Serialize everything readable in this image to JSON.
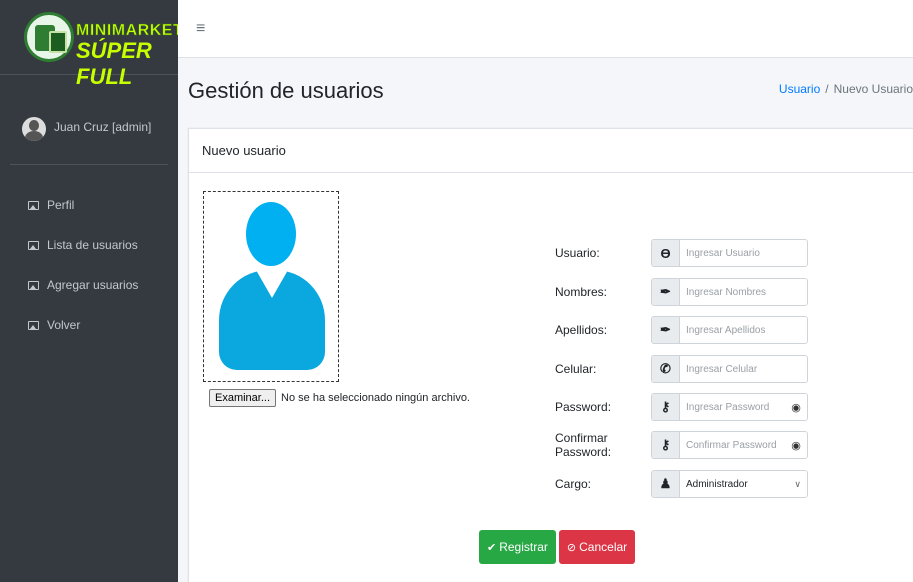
{
  "brand": {
    "line1": "MINIMARKET",
    "line2": "SÚPER FULL"
  },
  "user": {
    "name": "Juan Cruz [admin]"
  },
  "sidebar": {
    "items": [
      {
        "label": "Perfil"
      },
      {
        "label": "Lista de usuarios"
      },
      {
        "label": "Agregar usuarios"
      },
      {
        "label": "Volver"
      }
    ]
  },
  "topbar": {
    "menu_icon": "≡"
  },
  "page": {
    "title": "Gestión de usuarios"
  },
  "breadcrumb": {
    "link": "Usuario",
    "separator": "/",
    "current": "Nuevo Usuario"
  },
  "card": {
    "title": "Nuevo usuario"
  },
  "file": {
    "button": "Examinar...",
    "status": "No se ha seleccionado ningún archivo."
  },
  "form": {
    "usuario": {
      "label": "Usuario:",
      "placeholder": "Ingresar Usuario",
      "icon": "user-circle-icon"
    },
    "nombres": {
      "label": "Nombres:",
      "placeholder": "Ingresar Nombres",
      "icon": "signature-icon"
    },
    "apellidos": {
      "label": "Apellidos:",
      "placeholder": "Ingresar Apellidos",
      "icon": "signature-icon"
    },
    "celular": {
      "label": "Celular:",
      "placeholder": "Ingresar Celular",
      "icon": "phone-icon"
    },
    "password": {
      "label": "Password:",
      "placeholder": "Ingresar Password",
      "icon": "key-icon"
    },
    "confirm": {
      "label": "Confirmar Password:",
      "placeholder": "Confirmar Password",
      "icon": "key-icon"
    },
    "cargo": {
      "label": "Cargo:",
      "value": "Administrador",
      "icon": "user-tie-icon"
    }
  },
  "buttons": {
    "registrar": "Registrar",
    "cancelar": "Cancelar"
  },
  "colors": {
    "success": "#28a745",
    "danger": "#dc3545",
    "link": "#007bff",
    "sidebar": "#343a40"
  }
}
